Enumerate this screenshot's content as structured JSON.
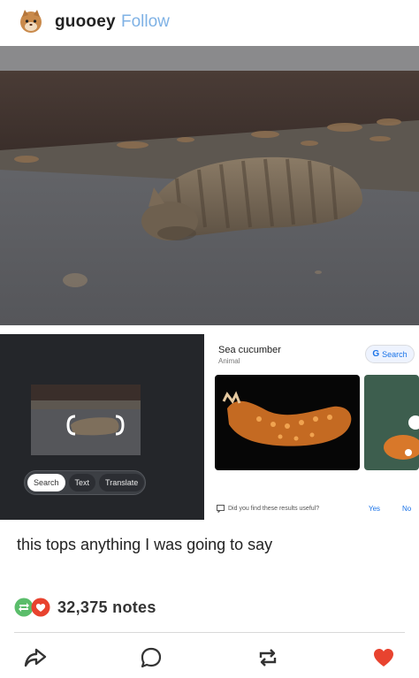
{
  "header": {
    "username": "guooey",
    "follow_label": "Follow",
    "avatar_icon": "cat-avatar-icon"
  },
  "post": {
    "photo_description_icon": "photo",
    "caption": "this tops anything I was going to say"
  },
  "lens_screenshot": {
    "chips": [
      {
        "label": "Search",
        "active": true
      },
      {
        "label": "Text",
        "active": false
      },
      {
        "label": "Translate",
        "active": false
      }
    ],
    "result_title": "Sea cucumber",
    "result_subtitle": "Animal",
    "search_button_label": "Search",
    "search_button_letter": "G",
    "feedback_question": "Did you find these results useful?",
    "feedback_yes": "Yes",
    "feedback_no": "No"
  },
  "notes": {
    "count": "32,375 notes",
    "icons": [
      "reblog-badge-icon",
      "heart-badge-icon"
    ]
  },
  "actions": [
    "share-icon",
    "reply-icon",
    "reblog-icon",
    "like-icon"
  ],
  "colors": {
    "follow": "#7fb2e5",
    "reblog_green": "#5bbd6b",
    "heart_red": "#e8432f",
    "google_blue": "#1a73e8"
  }
}
